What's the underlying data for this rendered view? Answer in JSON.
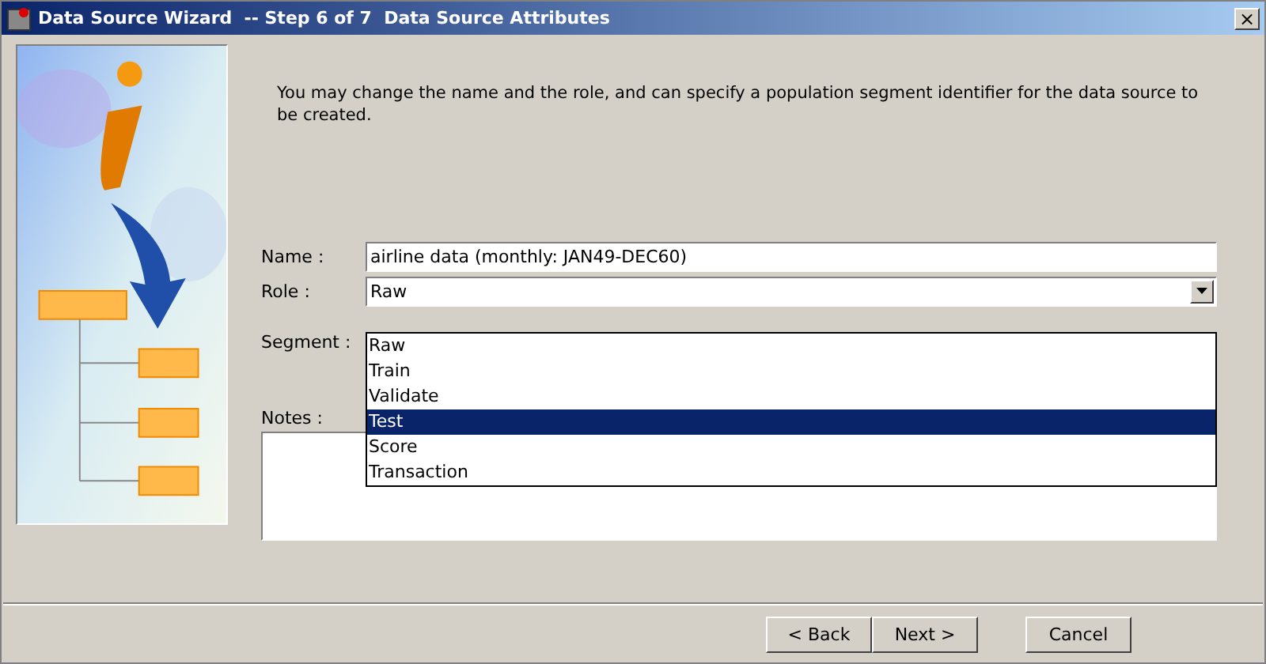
{
  "window": {
    "title": "Data Source Wizard  -- Step 6 of 7  Data Source Attributes",
    "close": "×"
  },
  "intro": "You may change the name and the role, and can specify a population segment identifier for the data source to be created.",
  "fields": {
    "name": {
      "label": "Name :",
      "value": "airline data (monthly: JAN49-DEC60)"
    },
    "role": {
      "label": "Role :",
      "value": "Raw",
      "expanded": true
    },
    "segment": {
      "label": "Segment :"
    },
    "notes": {
      "label": "Notes :"
    }
  },
  "role_options": [
    {
      "label": "Raw",
      "selected": false
    },
    {
      "label": "Train",
      "selected": false
    },
    {
      "label": "Validate",
      "selected": false
    },
    {
      "label": "Test",
      "selected": true
    },
    {
      "label": "Score",
      "selected": false
    },
    {
      "label": "Transaction",
      "selected": false
    }
  ],
  "buttons": [
    {
      "label": "< Back",
      "kind": "back"
    },
    {
      "label": "Next >",
      "kind": "next"
    },
    {
      "label": "Cancel",
      "kind": "cancel"
    }
  ]
}
